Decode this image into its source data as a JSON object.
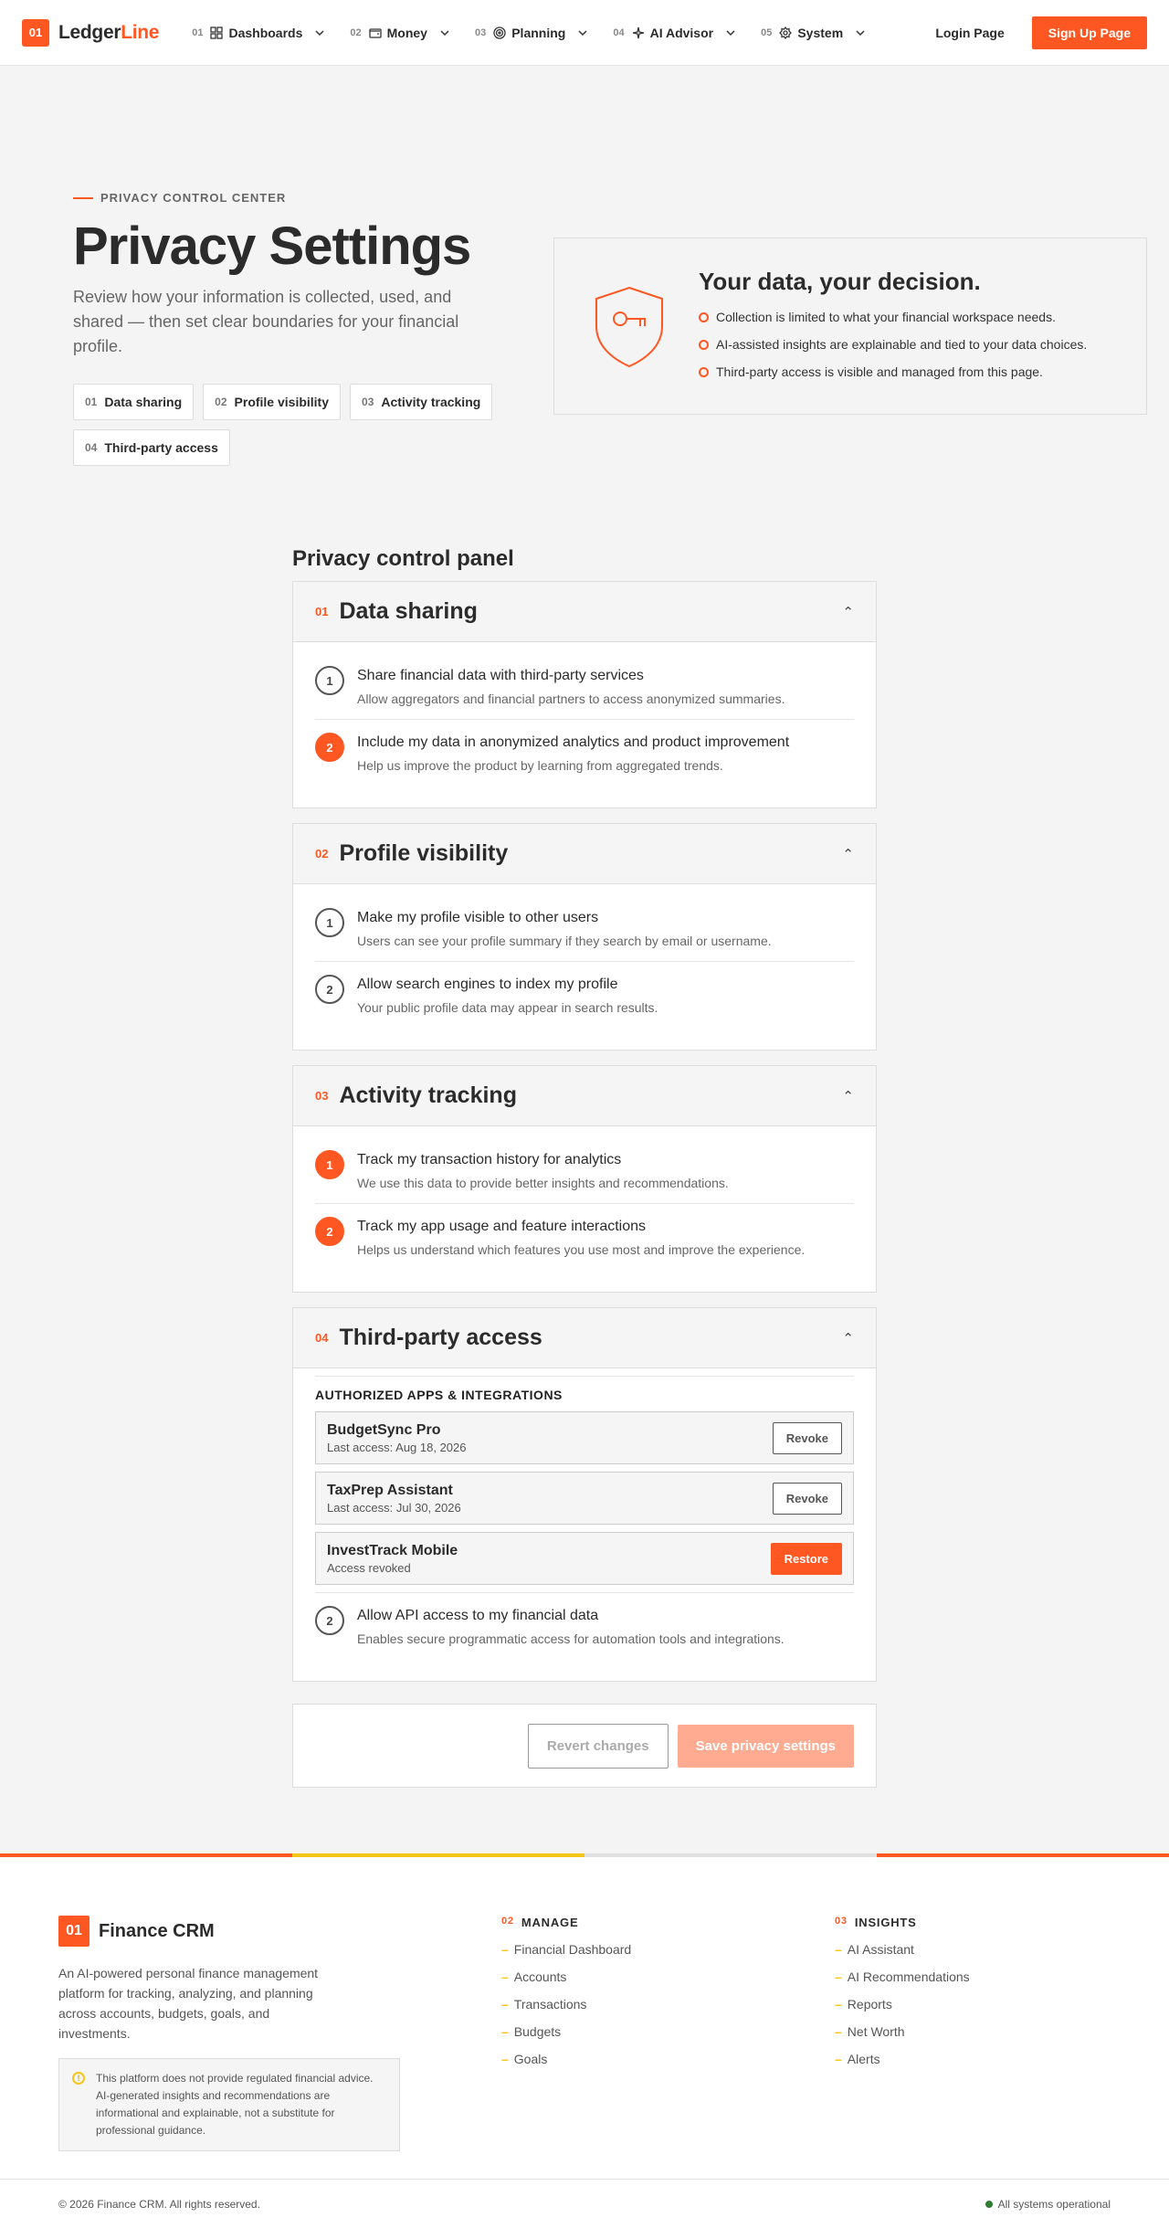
{
  "nav": {
    "logo_badge": "01",
    "logo_main": "Ledger",
    "logo_accent": "Line",
    "items": [
      {
        "num": "01",
        "label": "Dashboards",
        "icon": "grid-icon"
      },
      {
        "num": "02",
        "label": "Money",
        "icon": "wallet-icon"
      },
      {
        "num": "03",
        "label": "Planning",
        "icon": "target-icon"
      },
      {
        "num": "04",
        "label": "AI Advisor",
        "icon": "sparkle-icon"
      },
      {
        "num": "05",
        "label": "System",
        "icon": "gear-icon"
      }
    ],
    "login": "Login Page",
    "signup": "Sign Up Page"
  },
  "hero": {
    "eyebrow": "PRIVACY CONTROL CENTER",
    "title": "Privacy Settings",
    "subtitle": "Review how your information is collected, used, and shared — then set clear boundaries for your financial profile.",
    "chips": [
      {
        "num": "01",
        "label": "Data sharing"
      },
      {
        "num": "02",
        "label": "Profile visibility"
      },
      {
        "num": "03",
        "label": "Activity tracking"
      },
      {
        "num": "04",
        "label": "Third-party access"
      }
    ],
    "card": {
      "title": "Your data, your decision.",
      "points": [
        "Collection is limited to what your financial workspace needs.",
        "AI-assisted insights are explainable and tied to your data choices.",
        "Third-party access is visible and managed from this page."
      ]
    }
  },
  "panel": {
    "title": "Privacy control panel",
    "sections": [
      {
        "num": "01",
        "title": "Data sharing",
        "rows": [
          {
            "step": "1",
            "on": false,
            "title": "Share financial data with third-party services",
            "desc": "Allow aggregators and financial partners to access anonymized summaries."
          },
          {
            "step": "2",
            "on": true,
            "title": "Include my data in anonymized analytics and product improvement",
            "desc": "Help us improve the product by learning from aggregated trends."
          }
        ]
      },
      {
        "num": "02",
        "title": "Profile visibility",
        "rows": [
          {
            "step": "1",
            "on": false,
            "title": "Make my profile visible to other users",
            "desc": "Users can see your profile summary if they search by email or username."
          },
          {
            "step": "2",
            "on": false,
            "title": "Allow search engines to index my profile",
            "desc": "Your public profile data may appear in search results."
          }
        ]
      },
      {
        "num": "03",
        "title": "Activity tracking",
        "rows": [
          {
            "step": "1",
            "on": true,
            "title": "Track my transaction history for analytics",
            "desc": "We use this data to provide better insights and recommendations."
          },
          {
            "step": "2",
            "on": true,
            "title": "Track my app usage and feature interactions",
            "desc": "Helps us understand which features you use most and improve the experience."
          }
        ]
      }
    ],
    "third_party": {
      "num": "04",
      "title": "Third-party access",
      "apps_heading": "AUTHORIZED APPS & INTEGRATIONS",
      "apps": [
        {
          "name": "BudgetSync Pro",
          "sub": "Last access: Aug 18, 2026",
          "action": "Revoke",
          "revoked": false
        },
        {
          "name": "TaxPrep Assistant",
          "sub": "Last access: Jul 30, 2026",
          "action": "Revoke",
          "revoked": false
        },
        {
          "name": "InvestTrack Mobile",
          "sub": "Access revoked",
          "action": "Restore",
          "revoked": true
        }
      ],
      "row": {
        "step": "2",
        "on": false,
        "title": "Allow API access to my financial data",
        "desc": "Enables secure programmatic access for automation tools and integrations."
      }
    },
    "revert": "Revert changes",
    "save": "Save privacy settings"
  },
  "colors": {
    "accent": "#ff5722",
    "yellow": "#f5c518",
    "grey": "#e0e0e0"
  },
  "footer": {
    "badge": "01",
    "brand": "Finance CRM",
    "desc": "An AI-powered personal finance management platform for tracking, analyzing, and planning across accounts, budgets, goals, and investments.",
    "note": "This platform does not provide regulated financial advice. AI-generated insights and recommendations are informational and explainable, not a substitute for professional guidance.",
    "cols": [
      {
        "num": "02",
        "title": "MANAGE",
        "links": [
          "Financial Dashboard",
          "Accounts",
          "Transactions",
          "Budgets",
          "Goals"
        ]
      },
      {
        "num": "03",
        "title": "INSIGHTS",
        "links": [
          "AI Assistant",
          "AI Recommendations",
          "Reports",
          "Net Worth",
          "Alerts"
        ]
      }
    ],
    "copyright": "© 2026 Finance CRM. All rights reserved.",
    "status": "All systems operational"
  }
}
